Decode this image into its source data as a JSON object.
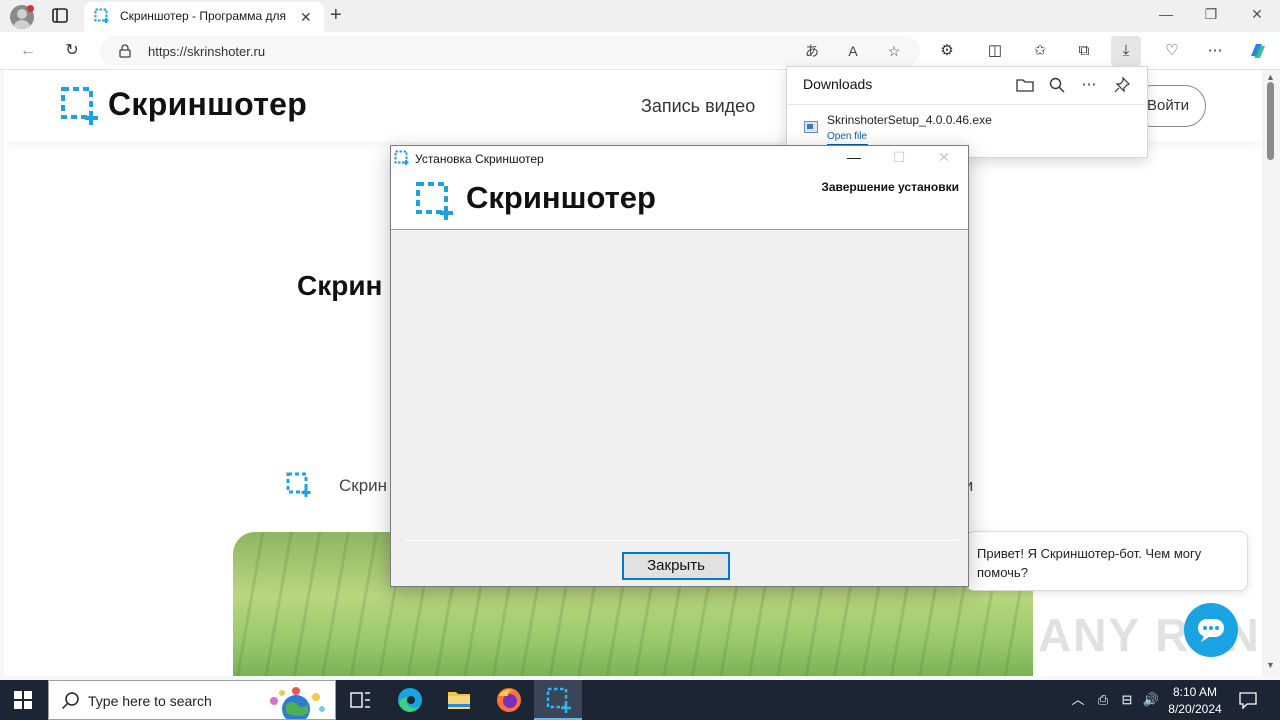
{
  "browser": {
    "tab_title": "Скриншотер - Программа для",
    "url": "https://skrinshoter.ru",
    "new_tab": "+",
    "close_tab": "✕",
    "window_controls": [
      "—",
      "❐",
      "✕"
    ],
    "toolbar_icons": [
      "read-aloud-translate-icon",
      "read-aloud-icon",
      "favorite-star-icon",
      "extensions-icon",
      "split-screen-icon",
      "favorites-icon",
      "collections-icon",
      "downloads-icon",
      "browser-essentials-icon",
      "more-icon",
      "copilot-icon"
    ]
  },
  "downloads_panel": {
    "title": "Downloads",
    "file_name": "SkrinshoterSetup_4.0.0.46.exe",
    "open_link": "Open file"
  },
  "site": {
    "logo_text": "Скриншотер",
    "nav_item": "Запись видео",
    "login_button": "Войти",
    "hero_title_partial": "Скрин",
    "feature_text_partial": "Скрин",
    "feature_text_tail": "ми",
    "chat_greeting": "Привет! Я Скриншотер-бот. Чем могу помочь?",
    "watermark": "ANY RUN"
  },
  "installer": {
    "window_title": "Установка Скриншотер",
    "logo_text": "Скриншотер",
    "heading": "Завершение установки",
    "close_button": "Закрыть",
    "controls": [
      "—",
      "☐",
      "✕"
    ]
  },
  "taskbar": {
    "search_placeholder": "Type here to search",
    "time": "8:10 AM",
    "date": "8/20/2024",
    "pinned_apps": [
      "task-view",
      "edge",
      "file-explorer",
      "firefox",
      "skrinshoter"
    ],
    "active_app": "skrinshoter"
  },
  "colors": {
    "brand_blue": "#1aa3e3",
    "accent": "#0078d7",
    "taskbar": "#1c2533"
  }
}
